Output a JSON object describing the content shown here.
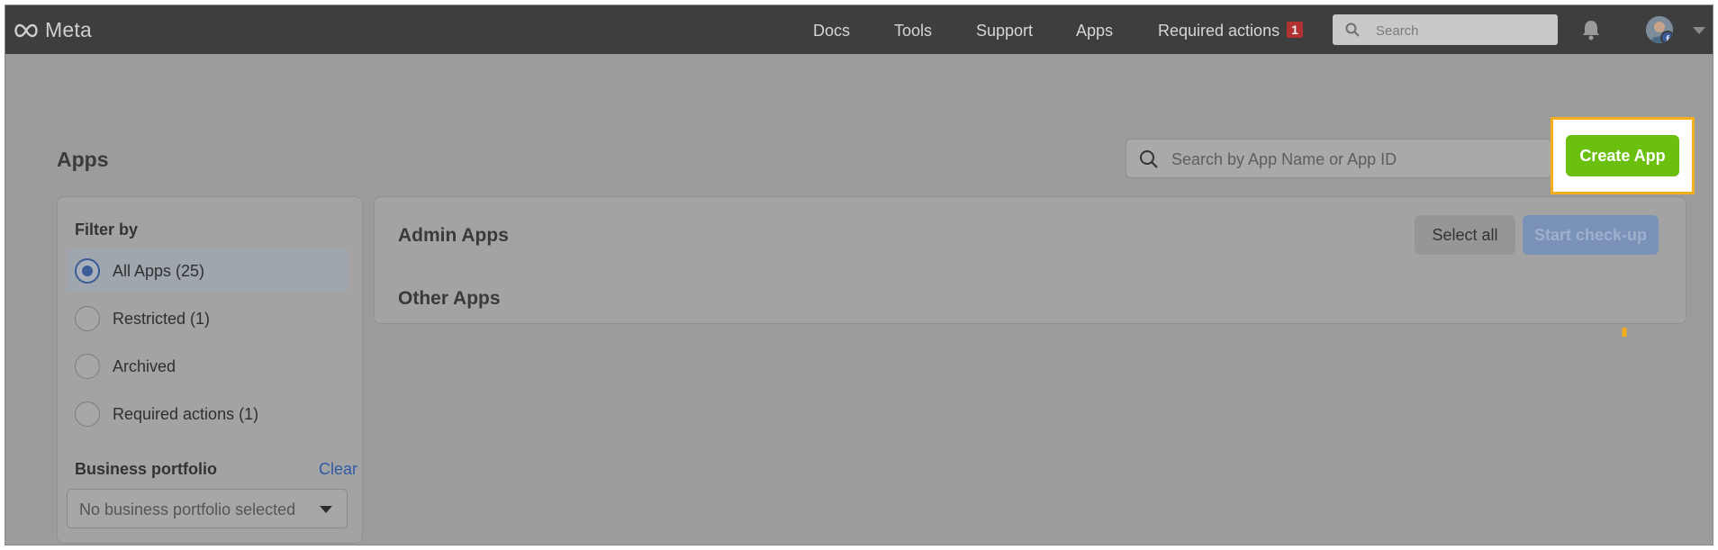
{
  "nav": {
    "logo_text": "Meta",
    "links": [
      "Docs",
      "Tools",
      "Support",
      "Apps",
      "Required actions"
    ],
    "required_actions_badge": "1",
    "search_placeholder": "Search"
  },
  "page": {
    "title": "Apps",
    "search_placeholder": "Search by App Name or App ID",
    "create_button": "Create App"
  },
  "filter": {
    "title": "Filter by",
    "options": [
      {
        "label": "All Apps (25)",
        "selected": true
      },
      {
        "label": "Restricted (1)",
        "selected": false
      },
      {
        "label": "Archived",
        "selected": false
      },
      {
        "label": "Required actions (1)",
        "selected": false
      }
    ],
    "business_portfolio": {
      "title": "Business portfolio",
      "clear_label": "Clear",
      "selected_value": "No business portfolio selected"
    }
  },
  "main": {
    "admin_apps_title": "Admin Apps",
    "other_apps_title": "Other Apps",
    "select_all_label": "Select all",
    "start_checkup_label": "Start check-up"
  },
  "colors": {
    "overlay_gray": "#9c9c9c",
    "nav_bar": "#3e3e3e",
    "create_button_green": "#6abf0f",
    "highlight_orange": "#f6ad1c",
    "link_blue": "#2f5ba6"
  }
}
